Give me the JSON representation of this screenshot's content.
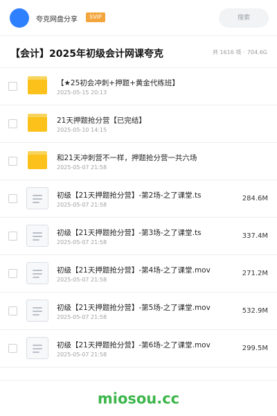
{
  "header": {
    "user_name": "夸克网盘分享",
    "vip_badge": "SVIP",
    "search_placeholder": "搜索"
  },
  "folder": {
    "title": "【会计】2025年初级会计网课夸克",
    "count_text": "共 1616 项",
    "separator": "·",
    "total_size": "704.6G"
  },
  "files": [
    {
      "type": "folder",
      "name": "【★25初会冲刺+押题+黄金代练班】",
      "date": "2025-05-15 20:13",
      "size": ""
    },
    {
      "type": "folder",
      "name": "21天押题抢分营【已完结】",
      "date": "2025-05-10 14:15",
      "size": ""
    },
    {
      "type": "folder",
      "name": "和21天冲刺营不一样，押题抢分营一共六场",
      "date": "2025-05-07 21:58",
      "size": ""
    },
    {
      "type": "file",
      "name": "初级【21天押题抢分营】-第2场-之了课堂.ts",
      "date": "2025-05-07 21:58",
      "size": "284.6M"
    },
    {
      "type": "file",
      "name": "初级【21天押题抢分营】-第3场-之了课堂.ts",
      "date": "2025-05-07 21:58",
      "size": "337.4M"
    },
    {
      "type": "file",
      "name": "初级【21天押题抢分营】-第4场-之了课堂.mov",
      "date": "2025-05-07 21:58",
      "size": "271.2M"
    },
    {
      "type": "file",
      "name": "初级【21天押题抢分营】-第5场-之了课堂.mov",
      "date": "2025-05-07 21:58",
      "size": "532.9M"
    },
    {
      "type": "file",
      "name": "初级【21天押题抢分营】-第6场-之了课堂.mov",
      "date": "2025-05-07 21:58",
      "size": "299.5M"
    }
  ],
  "watermark": "miosou.cc",
  "colors": {
    "avatar": "#2f80ff",
    "vip_badge": "#f3a53b",
    "folder": "#fcc21b",
    "watermark": "#3cb54a"
  }
}
